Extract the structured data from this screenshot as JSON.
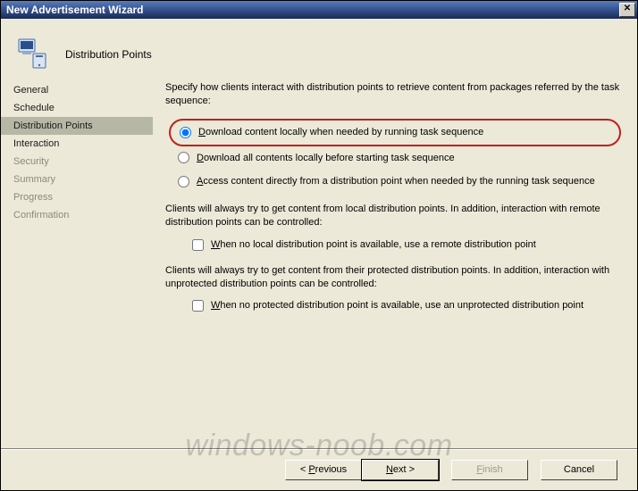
{
  "window": {
    "title": "New Advertisement Wizard"
  },
  "header": {
    "page_title": "Distribution Points"
  },
  "sidebar": {
    "items": [
      {
        "label": "General",
        "selected": false,
        "faded": false
      },
      {
        "label": "Schedule",
        "selected": false,
        "faded": false
      },
      {
        "label": "Distribution Points",
        "selected": true,
        "faded": false
      },
      {
        "label": "Interaction",
        "selected": false,
        "faded": false
      },
      {
        "label": "Security",
        "selected": false,
        "faded": true
      },
      {
        "label": "Summary",
        "selected": false,
        "faded": true
      },
      {
        "label": "Progress",
        "selected": false,
        "faded": true
      },
      {
        "label": "Confirmation",
        "selected": false,
        "faded": true
      }
    ]
  },
  "main": {
    "intro": "Specify how clients interact with distribution points to retrieve content from packages referred by the task sequence:",
    "radios": [
      {
        "key": "download-needed",
        "underline": "D",
        "rest": "ownload content locally when needed by running task sequence",
        "checked": true,
        "highlight": true
      },
      {
        "key": "download-all",
        "underline": "D",
        "rest": "ownload all contents locally before starting task sequence",
        "checked": false,
        "highlight": false
      },
      {
        "key": "access-direct",
        "underline": "A",
        "rest": "ccess content directly from a distribution point when needed by the running task sequence",
        "checked": false,
        "highlight": false
      }
    ],
    "note1": "Clients will always try to get content from local distribution points. In addition, interaction with remote distribution points can be controlled:",
    "check1": {
      "underline": "W",
      "rest": "hen no local distribution point is available, use a remote distribution point",
      "checked": false
    },
    "note2": "Clients will always try to get content from their protected distribution points. In addition, interaction with unprotected distribution points can be controlled:",
    "check2": {
      "underline": "W",
      "rest": "hen no protected distribution point is available, use an unprotected distribution point",
      "checked": false
    }
  },
  "buttons": {
    "previous": {
      "underline": "P",
      "prefix": "< ",
      "rest": "revious"
    },
    "next": {
      "underline": "N",
      "rest": "ext >"
    },
    "finish": {
      "underline": "F",
      "rest": "inish"
    },
    "cancel": {
      "label": "Cancel"
    }
  },
  "watermark": "windows-noob.com"
}
